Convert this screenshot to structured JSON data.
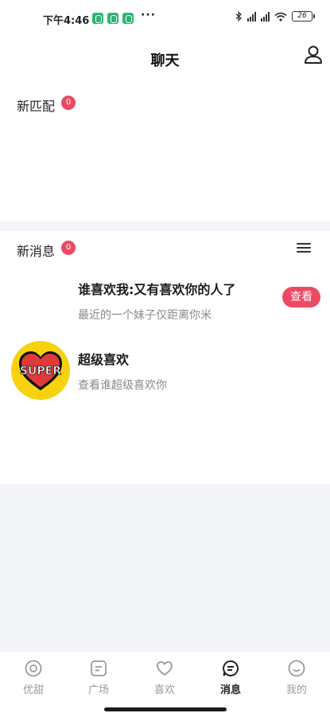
{
  "status_bar": {
    "time": "下午4:46",
    "dots": "···",
    "battery": "26"
  },
  "header": {
    "title": "聊天"
  },
  "new_matches": {
    "label": "新匹配",
    "count": "0"
  },
  "new_messages": {
    "label": "新消息",
    "count": "0",
    "items": [
      {
        "title": "谁喜欢我:又有喜欢你的人了",
        "subtitle": "最近的一个妹子仅距离你米",
        "action": "查看"
      },
      {
        "title": "超级喜欢",
        "subtitle": "查看谁超级喜欢你",
        "avatar_text": "SUPER"
      }
    ]
  },
  "tabs": [
    {
      "label": "优甜",
      "icon": "target-icon",
      "active": false
    },
    {
      "label": "广场",
      "icon": "square-doc-icon",
      "active": false
    },
    {
      "label": "喜欢",
      "icon": "heart-icon",
      "active": false
    },
    {
      "label": "消息",
      "icon": "chat-icon",
      "active": true
    },
    {
      "label": "我的",
      "icon": "smile-icon",
      "active": false
    }
  ],
  "colors": {
    "accent": "#ec4a63",
    "super_bg": "#f7d20f",
    "status_app": "#2bb673"
  }
}
